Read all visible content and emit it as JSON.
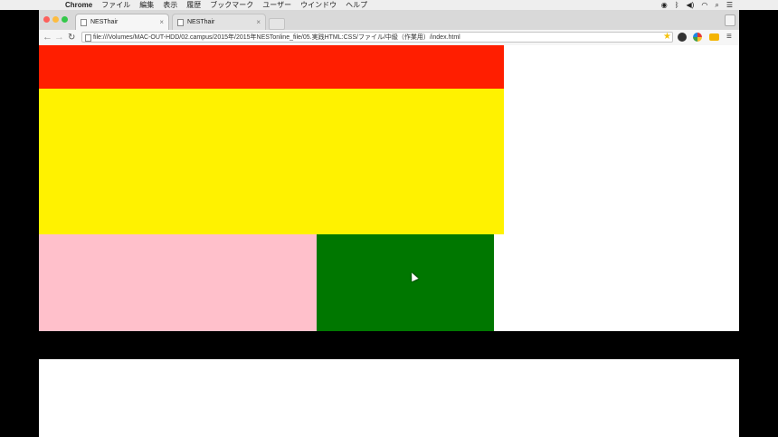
{
  "menubar": {
    "apple": "",
    "app": "Chrome",
    "menus": [
      "ファイル",
      "編集",
      "表示",
      "履歴",
      "ブックマーク",
      "ユーザー",
      "ウインドウ",
      "ヘルプ"
    ]
  },
  "tabs": [
    {
      "title": "NESThair",
      "active": true
    },
    {
      "title": "NESThair",
      "active": false
    }
  ],
  "toolbar": {
    "url": "file:///Volumes/MAC-OUT-HDD/02.campus/2015年/2015年NESTonline_file/05.実践HTML:CSS/ファイル/中級（作業用）/index.html"
  },
  "page": {
    "boxes": [
      {
        "name": "red",
        "color": "#ff1e00"
      },
      {
        "name": "yellow",
        "color": "#fff200"
      },
      {
        "name": "pink",
        "color": "#ffc0cb"
      },
      {
        "name": "green",
        "color": "#007700"
      }
    ]
  }
}
